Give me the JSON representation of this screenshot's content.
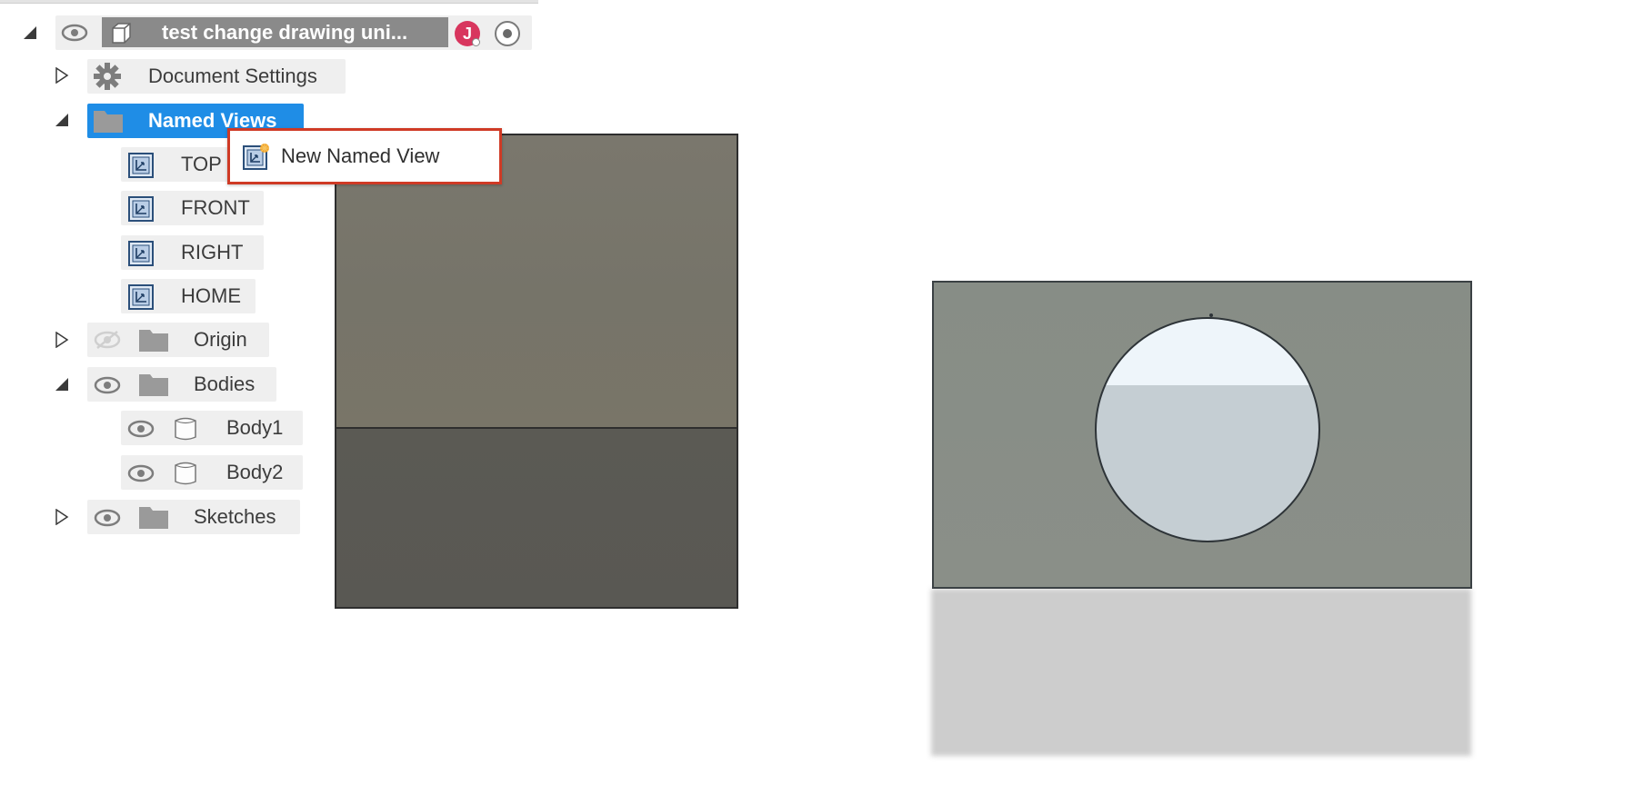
{
  "browser": {
    "root": {
      "title": "test change drawing uni...",
      "avatar_initial": "J",
      "eye_icon": "eye-icon",
      "component_icon": "component-icon"
    },
    "items": [
      {
        "label": "Document Settings",
        "icon": "gear-icon",
        "expanded": false
      },
      {
        "label": "Named Views",
        "icon": "folder-icon",
        "expanded": true,
        "selected": true
      },
      {
        "label": "TOP",
        "icon": "named-view-icon"
      },
      {
        "label": "FRONT",
        "icon": "named-view-icon"
      },
      {
        "label": "RIGHT",
        "icon": "named-view-icon"
      },
      {
        "label": "HOME",
        "icon": "named-view-icon"
      },
      {
        "label": "Origin",
        "icon": "folder-icon",
        "visibility": "hidden",
        "expanded": false
      },
      {
        "label": "Bodies",
        "icon": "folder-icon",
        "visibility": "visible",
        "expanded": true
      },
      {
        "label": "Body1",
        "icon": "body-icon",
        "visibility": "visible"
      },
      {
        "label": "Body2",
        "icon": "body-icon",
        "visibility": "visible"
      },
      {
        "label": "Sketches",
        "icon": "folder-icon",
        "visibility": "visible",
        "expanded": false
      }
    ]
  },
  "context_menu": {
    "items": [
      {
        "label": "New Named View",
        "icon": "new-named-view-icon"
      }
    ],
    "highlight_color": "#cf3a25"
  },
  "colors": {
    "selection": "#1f8de6",
    "avatar": "#d8365e",
    "row_background": "#efefef"
  }
}
